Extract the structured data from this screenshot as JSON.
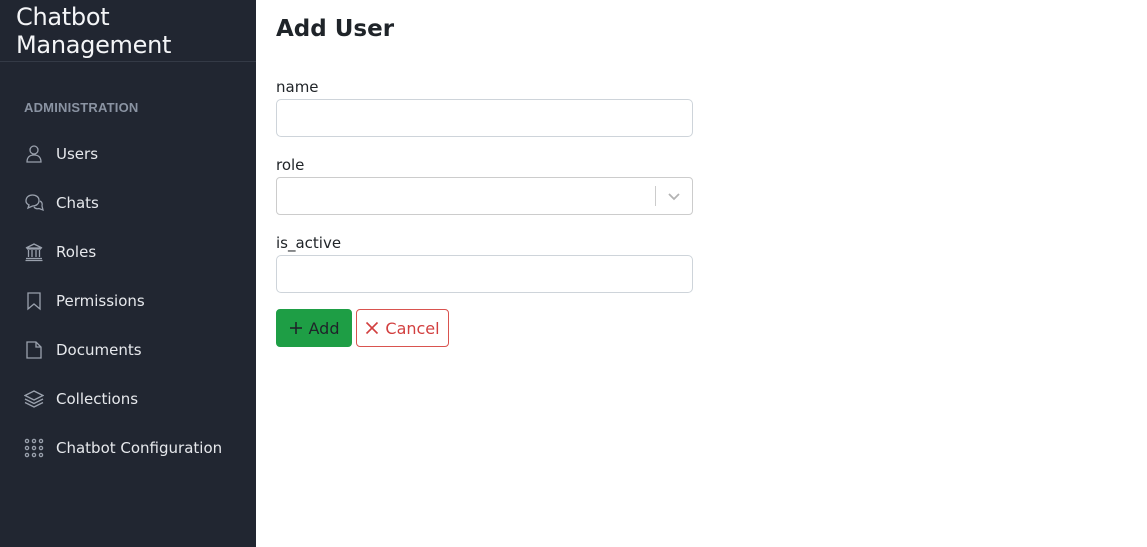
{
  "sidebar": {
    "brand": "Chatbot Management",
    "section_title": "ADMINISTRATION",
    "items": [
      {
        "label": "Users",
        "icon": "user-icon"
      },
      {
        "label": "Chats",
        "icon": "chat-bubbles-icon"
      },
      {
        "label": "Roles",
        "icon": "bank-icon"
      },
      {
        "label": "Permissions",
        "icon": "bookmark-icon"
      },
      {
        "label": "Documents",
        "icon": "document-icon"
      },
      {
        "label": "Collections",
        "icon": "layers-icon"
      },
      {
        "label": "Chatbot Configuration",
        "icon": "grid-dots-icon"
      }
    ]
  },
  "main": {
    "title": "Add User",
    "fields": {
      "name": {
        "label": "name",
        "value": ""
      },
      "role": {
        "label": "role",
        "value": ""
      },
      "is_active": {
        "label": "is_active",
        "value": ""
      }
    },
    "buttons": {
      "add_label": "Add",
      "cancel_label": "Cancel"
    }
  },
  "colors": {
    "sidebar_bg": "#212631",
    "add_button": "#1e9e45",
    "cancel_border": "#d9534f"
  }
}
